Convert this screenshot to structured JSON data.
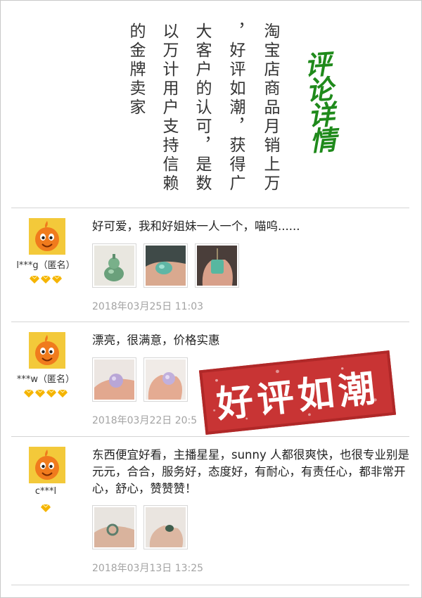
{
  "header": {
    "columns": [
      "淘宝店商品月销上万",
      "，好评如潮，获得广",
      "大客户的认可，是数",
      "以万计用户支持信赖",
      "的金牌卖家"
    ],
    "brush_title": "评论详情"
  },
  "reviews": [
    {
      "user": "l***g（匿名）",
      "level": 3,
      "comment": "好可爱，我和好姐妹一人一个，喵呜......",
      "photos": [
        "jade-gourd-photo",
        "jade-in-hand-photo",
        "jade-pendant-photo"
      ],
      "date": "2018年03月25日 11:03"
    },
    {
      "user": "***w（匿名）",
      "level": 4,
      "comment": "漂亮，很满意，价格实惠",
      "photos": [
        "jade-bead-photo",
        "jade-bead-photo"
      ],
      "date": "2018年03月22日 20:5"
    },
    {
      "user": "c***l",
      "level": 1,
      "comment": "东西便宜好看，主播星星，sunny 人都很爽快，也很专业别是元元，合合，服务好，态度好，有耐心，有责任心，都非常开心，舒心，赞赞赞！",
      "photos": [
        "jade-ring-photo",
        "jade-ring-photo"
      ],
      "date": "2018年03月13日 13:25"
    }
  ],
  "stamp": {
    "text": "好评如潮"
  },
  "colors": {
    "brush_green": "#1f8a1b",
    "stamp_red": "#c83434",
    "date_gray": "#a3a3a3",
    "avatar_orange": "#f07b1d",
    "gem_gold": "#f5b400"
  }
}
